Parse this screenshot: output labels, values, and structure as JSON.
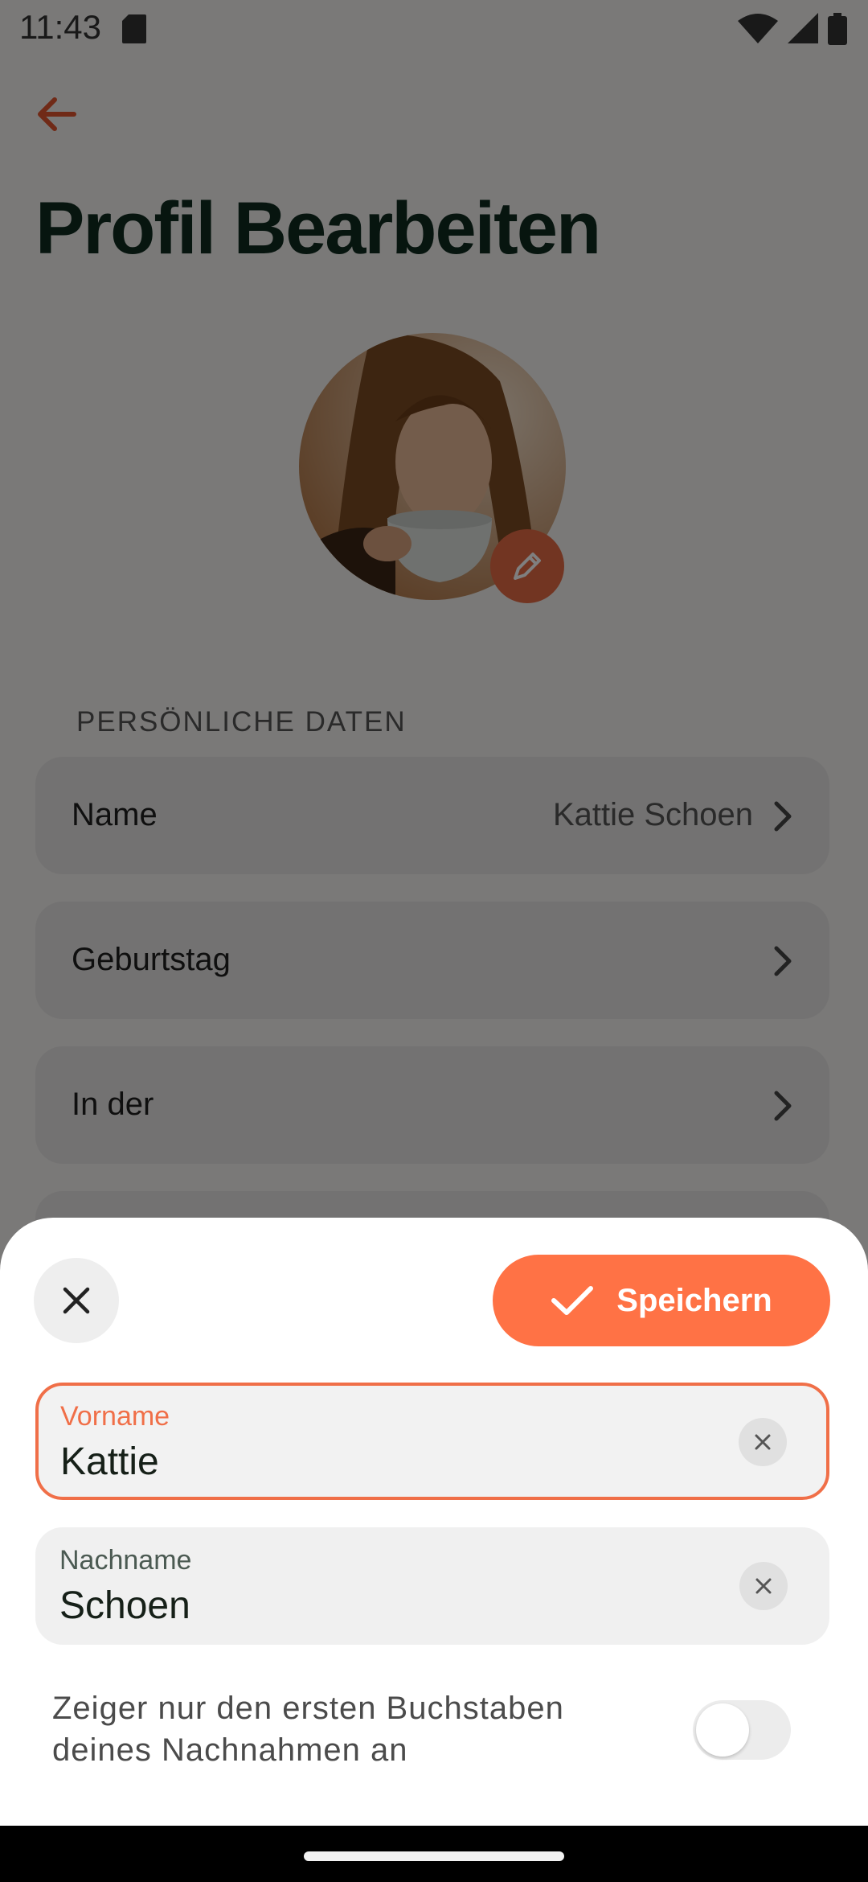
{
  "status_bar": {
    "time": "11:43"
  },
  "header": {
    "title": "Profil Bearbeiten"
  },
  "personal_section": {
    "label": "PERSÖNLICHE DATEN",
    "rows": [
      {
        "label": "Name",
        "value": "Kattie Schoen"
      },
      {
        "label": "Geburtstag",
        "value": ""
      },
      {
        "label": "In der",
        "value": ""
      }
    ]
  },
  "sheet": {
    "save_label": "Speichern",
    "first_name": {
      "label": "Vorname",
      "value": "Kattie"
    },
    "last_name": {
      "label": "Nachname",
      "value": "Schoen"
    },
    "toggle_text": "Zeiger nur den ersten Buchstaben deines Nachnahmen an",
    "toggle_on": false
  },
  "colors": {
    "accent": "#ff7245",
    "focus": "#f06f48",
    "title": "#0f2a1f"
  }
}
